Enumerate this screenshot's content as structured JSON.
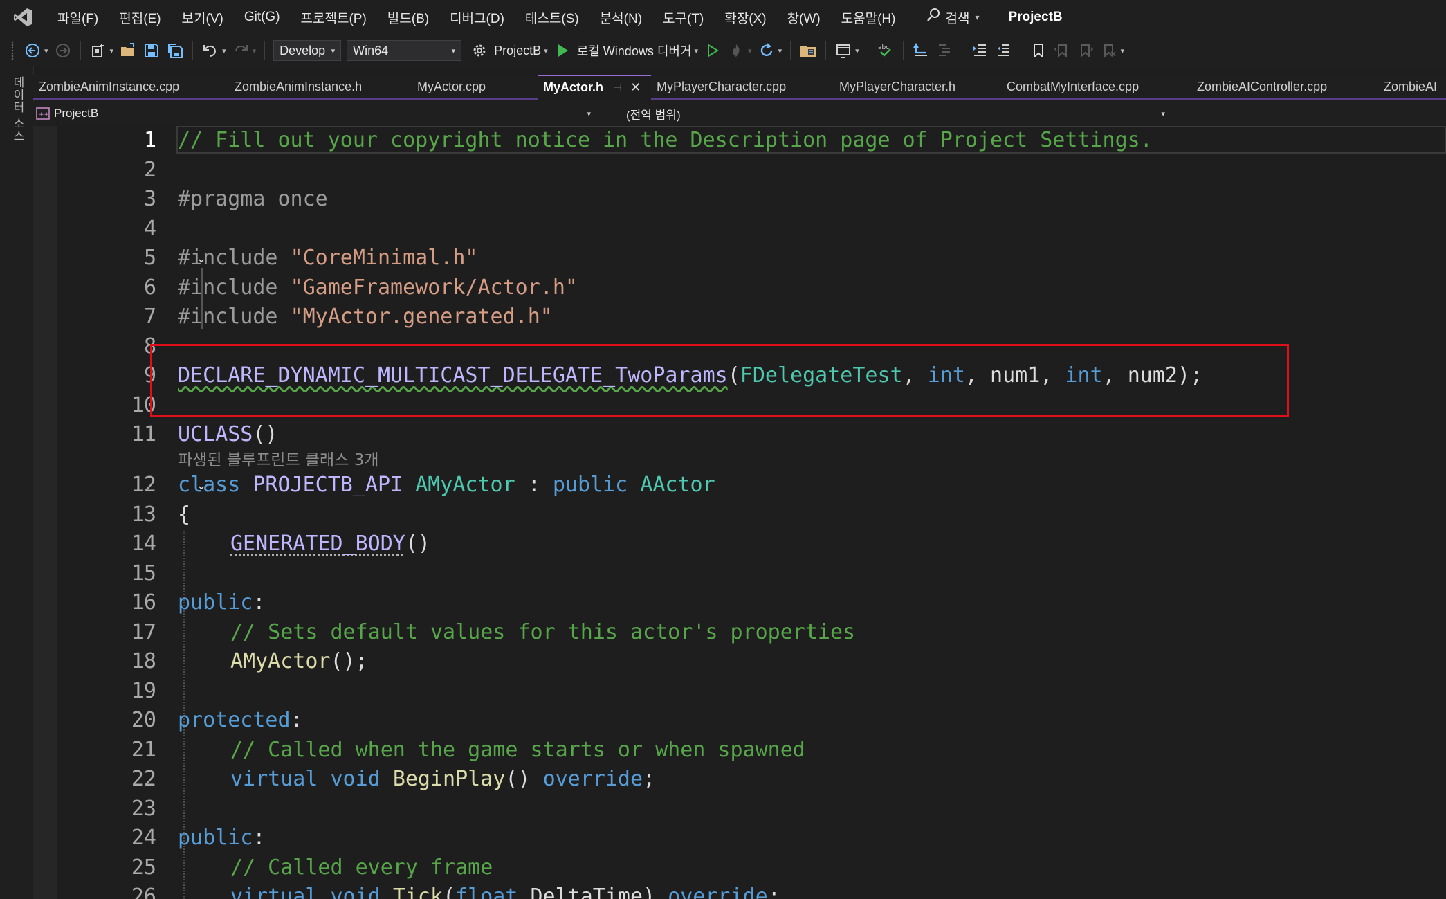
{
  "menu": {
    "items": [
      "파일(F)",
      "편집(E)",
      "보기(V)",
      "Git(G)",
      "프로젝트(P)",
      "빌드(B)",
      "디버그(D)",
      "테스트(S)",
      "분석(N)",
      "도구(T)",
      "확장(X)",
      "창(W)",
      "도움말(H)"
    ],
    "search_label": "검색",
    "project_title": "ProjectB"
  },
  "toolbar": {
    "configuration": "Develop",
    "platform": "Win64",
    "startup_project": "ProjectB",
    "debugger_label": "로컬 Windows 디버거",
    "colors": {
      "run": "#3fb950",
      "accent": "#75beff"
    }
  },
  "left_strip": {
    "label": "데이터 소스"
  },
  "tabs": [
    {
      "label": "ZombieAnimInstance.cpp",
      "active": false
    },
    {
      "label": "ZombieAnimInstance.h",
      "active": false
    },
    {
      "label": "MyActor.cpp",
      "active": false
    },
    {
      "label": "MyActor.h",
      "active": true
    },
    {
      "label": "MyPlayerCharacter.cpp",
      "active": false
    },
    {
      "label": "MyPlayerCharacter.h",
      "active": false
    },
    {
      "label": "CombatMyInterface.cpp",
      "active": false
    },
    {
      "label": "ZombieAIController.cpp",
      "active": false
    },
    {
      "label": "ZombieAI",
      "active": false
    }
  ],
  "navbar": {
    "project": "ProjectB",
    "scope": "(전역 범위)"
  },
  "editor": {
    "current_line": 1,
    "line_numbers": [
      "1",
      "2",
      "3",
      "4",
      "5",
      "6",
      "7",
      "8",
      "9",
      "10",
      "11",
      "12",
      "13",
      "14",
      "15",
      "16",
      "17",
      "18",
      "19",
      "20",
      "21",
      "22",
      "23",
      "24",
      "25",
      "26"
    ],
    "codelens_hint": "파생된 블루프린트 클래스 3개",
    "lines": {
      "l1": "// Fill out your copyright notice in the Description page of Project Settings.",
      "l3": "#pragma once",
      "l5_pp": "#include ",
      "l5_str": "\"CoreMinimal.h\"",
      "l6_pp": "#include ",
      "l6_str": "\"GameFramework/Actor.h\"",
      "l7_pp": "#include ",
      "l7_str": "\"MyActor.generated.h\"",
      "l9_macro": "DECLARE_DYNAMIC_MULTICAST_DELEGATE_TwoParams",
      "l9_open": "(",
      "l9_type": "FDelegateTest",
      "l9_c1": ", ",
      "l9_int1": "int",
      "l9_c2": ", num1, ",
      "l9_int2": "int",
      "l9_end": ", num2);",
      "l11_macro": "UCLASS",
      "l11_end": "()",
      "l12_kw": "class ",
      "l12_api": "PROJECTB_API ",
      "l12_type": "AMyActor",
      "l12_colon": " : ",
      "l12_pub": "public ",
      "l12_base": "AActor",
      "l13": "{",
      "l14_macro": "GENERATED_BODY",
      "l14_end": "()",
      "l16_kw": "public",
      "l16_end": ":",
      "l17": "// Sets default values for this actor's properties",
      "l18_fn": "AMyActor",
      "l18_end": "();",
      "l20_kw": "protected",
      "l20_end": ":",
      "l21": "// Called when the game starts or when spawned",
      "l22_virt": "virtual ",
      "l22_void": "void ",
      "l22_fn": "BeginPlay",
      "l22_paren": "() ",
      "l22_ov": "override",
      "l22_end": ";",
      "l24_kw": "public",
      "l24_end": ":",
      "l25": "// Called every frame",
      "l26_virt": "virtual ",
      "l26_void": "void ",
      "l26_fn": "Tick",
      "l26_open": "(",
      "l26_float": "float",
      "l26_param": " DeltaTime) ",
      "l26_ov": "override",
      "l26_end": ";"
    }
  }
}
